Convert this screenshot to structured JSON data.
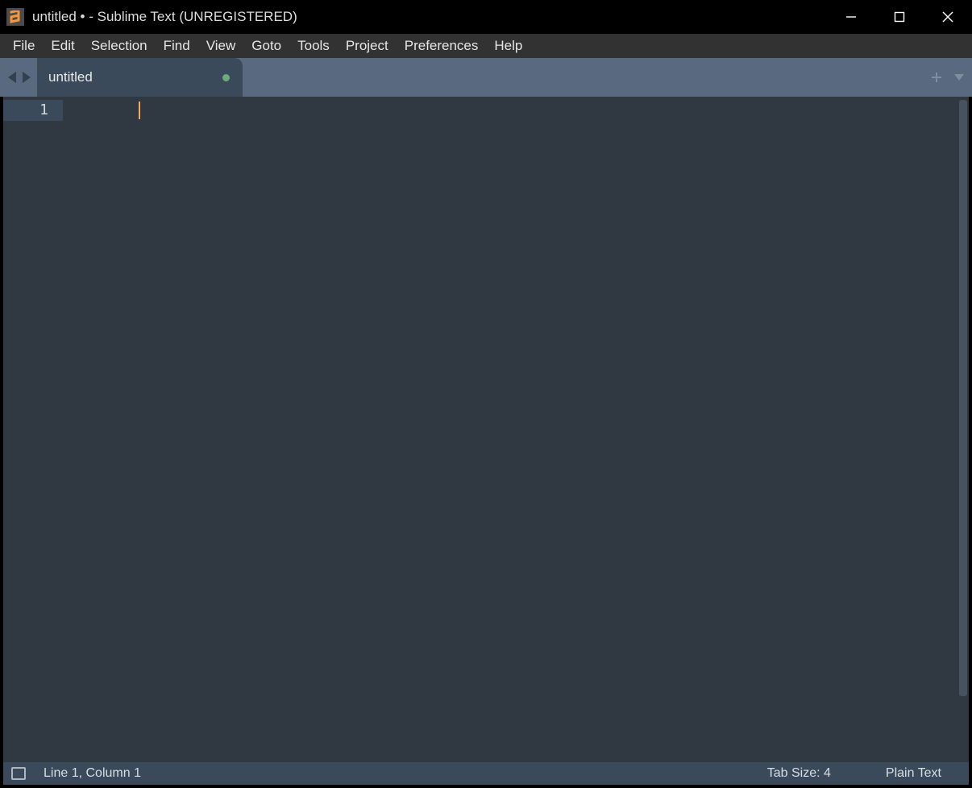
{
  "titlebar": {
    "title": "untitled • - Sublime Text (UNREGISTERED)"
  },
  "menubar": {
    "items": [
      "File",
      "Edit",
      "Selection",
      "Find",
      "View",
      "Goto",
      "Tools",
      "Project",
      "Preferences",
      "Help"
    ]
  },
  "tabs": {
    "active": {
      "label": "untitled",
      "dirty": true
    }
  },
  "editor": {
    "line_number": "1"
  },
  "statusbar": {
    "position": "Line 1, Column 1",
    "tab_size": "Tab Size: 4",
    "syntax": "Plain Text"
  }
}
